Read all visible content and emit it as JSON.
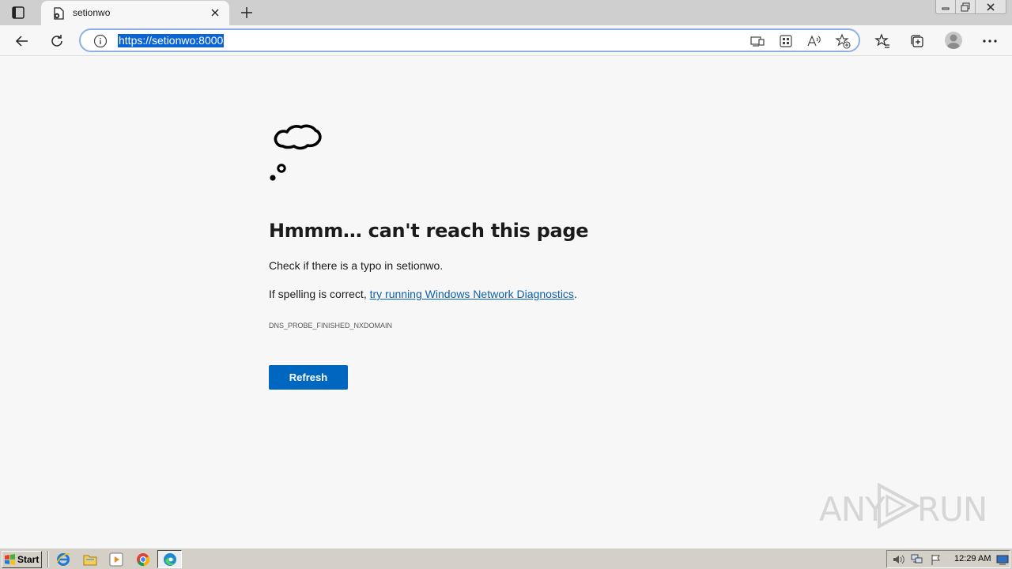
{
  "browser": {
    "tab": {
      "title": "setionwo",
      "favicon": "page-error-icon",
      "close_icon": "close-icon"
    },
    "new_tab_icon": "plus-icon",
    "window_controls": [
      "minimize-icon",
      "restore-icon",
      "close-icon"
    ],
    "toolbar": {
      "back_icon": "back-arrow-icon",
      "reload_icon": "reload-icon",
      "address": {
        "info_icon": "info-icon",
        "url": "https://setionwo:8000"
      },
      "address_icons": [
        "immersive-reader-icon",
        "apps-icon",
        "read-aloud-icon",
        "add-favorite-icon"
      ],
      "right_icons": [
        "favorites-icon",
        "collections-icon",
        "profile-avatar",
        "more-icon"
      ]
    }
  },
  "error": {
    "illustration": "thought-cloud-icon",
    "title": "Hmmm… can't reach this page",
    "line1": "Check if there is a typo in setionwo.",
    "line2_prefix": "If spelling is correct, ",
    "line2_link": "try running Windows Network Diagnostics",
    "line2_suffix": ".",
    "code": "DNS_PROBE_FINISHED_NXDOMAIN",
    "refresh_label": "Refresh"
  },
  "watermark": {
    "left": "ANY",
    "right": "RUN"
  },
  "taskbar": {
    "start_label": "Start",
    "quick_launch": [
      "ie-icon",
      "folder-icon",
      "media-player-icon",
      "chrome-icon",
      "edge-icon"
    ],
    "tray_icons": [
      "volume-icon",
      "network-icon",
      "flag-icon"
    ],
    "clock": "12:29 AM",
    "show_desktop_icon": "desktop-icon"
  }
}
